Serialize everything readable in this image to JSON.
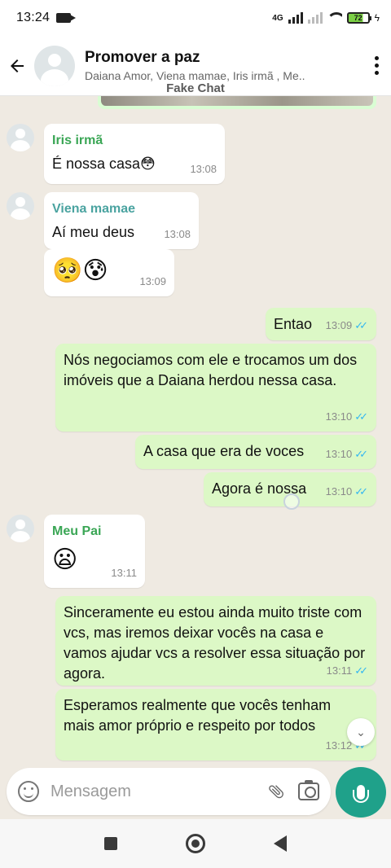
{
  "status": {
    "time": "13:24",
    "network": "4G",
    "battery": "72"
  },
  "header": {
    "title": "Promover a paz",
    "subtitle": "Daiana Amor, Viena mamae, Iris irmã , Me.."
  },
  "watermark": "Fake Chat",
  "colors": {
    "outgoing": "#dcf8c6",
    "incoming": "#ffffff",
    "accent": "#1fa18a",
    "sender_iris": "#3aa655",
    "sender_viena": "#4aa3a0",
    "sender_pai": "#3aa655"
  },
  "messages": [
    {
      "direction": "in",
      "sender": "Iris irmã",
      "text": "É nossa casa😳",
      "time": "13:08"
    },
    {
      "direction": "in",
      "sender": "Viena mamae",
      "text": "Aí meu deus",
      "time": "13:08"
    },
    {
      "direction": "in",
      "sender": "",
      "text": "🥺😰",
      "time": "13:09"
    },
    {
      "direction": "out",
      "text": "Entao",
      "time": "13:09",
      "status": "read"
    },
    {
      "direction": "out",
      "text": "Nós negociamos com ele e trocamos um dos imóveis que a Daiana herdou nessa casa.",
      "time": "13:10",
      "status": "read"
    },
    {
      "direction": "out",
      "text": "A casa que era de voces",
      "time": "13:10",
      "status": "read"
    },
    {
      "direction": "out",
      "text": "Agora é nossa",
      "time": "13:10",
      "status": "read"
    },
    {
      "direction": "in",
      "sender": "Meu Pai",
      "text": "😦",
      "time": "13:11"
    },
    {
      "direction": "out",
      "text": "Sinceramente eu estou ainda muito triste com vcs, mas iremos deixar vocês na casa e vamos ajudar vcs a resolver essa situação por agora.",
      "time": "13:11",
      "status": "read"
    },
    {
      "direction": "out",
      "text": "Esperamos realmente que vocês tenham mais amor próprio e respeito por todos",
      "time": "13:12",
      "status": "read"
    }
  ],
  "composer": {
    "placeholder": "Mensagem"
  },
  "icons": [
    "back-arrow-icon",
    "more-options-icon",
    "emoji-icon",
    "attach-icon",
    "camera-icon",
    "mic-icon",
    "scroll-down-icon"
  ]
}
